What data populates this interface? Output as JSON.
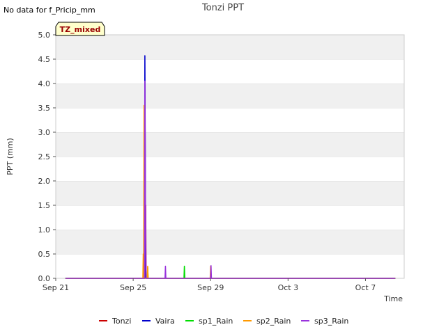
{
  "chart_data": {
    "type": "line",
    "title": "Tonzi PPT",
    "note": "No data for f_Pricip_mm",
    "badge": "TZ_mixed",
    "xlabel": "Time",
    "ylabel": "PPT (mm)",
    "xlim": [
      "2023-09-21",
      "2023-10-09"
    ],
    "ylim": [
      0,
      5.0
    ],
    "x_ticks": [
      {
        "date": "2023-09-21",
        "label": "Sep 21"
      },
      {
        "date": "2023-09-25",
        "label": "Sep 25"
      },
      {
        "date": "2023-09-29",
        "label": "Sep 29"
      },
      {
        "date": "2023-10-03",
        "label": "Oct 3"
      },
      {
        "date": "2023-10-07",
        "label": "Oct 7"
      }
    ],
    "y_ticks": [
      "0.0",
      "0.5",
      "1.0",
      "1.5",
      "2.0",
      "2.5",
      "3.0",
      "3.5",
      "4.0",
      "4.5",
      "5.0"
    ],
    "grid": true,
    "legend_position": "bottom",
    "series": [
      {
        "name": "Tonzi",
        "color": "#cc0000",
        "points": [
          [
            "2023-09-21T12:00",
            0
          ],
          [
            "2023-09-25T13:00",
            0
          ],
          [
            "2023-09-25T13:30",
            0.75
          ],
          [
            "2023-09-25T14:00",
            0
          ],
          [
            "2023-09-25T15:00",
            0
          ],
          [
            "2023-09-25T15:30",
            1.5
          ],
          [
            "2023-09-25T16:00",
            0
          ],
          [
            "2023-10-08T13:00",
            0
          ]
        ]
      },
      {
        "name": "Vaira",
        "color": "#0000cc",
        "points": [
          [
            "2023-09-21T12:00",
            0
          ],
          [
            "2023-09-25T14:00",
            0
          ],
          [
            "2023-09-25T14:30",
            4.57
          ],
          [
            "2023-09-25T15:00",
            2.55
          ],
          [
            "2023-09-25T15:30",
            0
          ],
          [
            "2023-10-08T13:00",
            0
          ]
        ]
      },
      {
        "name": "sp1_Rain",
        "color": "#00dd00",
        "points": [
          [
            "2023-09-21T12:00",
            0
          ],
          [
            "2023-09-25T17:30",
            0
          ],
          [
            "2023-09-25T18:00",
            0.22
          ],
          [
            "2023-09-25T18:30",
            0
          ],
          [
            "2023-09-27T15:00",
            0
          ],
          [
            "2023-09-27T15:30",
            0.25
          ],
          [
            "2023-09-27T16:00",
            0
          ],
          [
            "2023-10-08T13:00",
            0
          ]
        ]
      },
      {
        "name": "sp2_Rain",
        "color": "#ff9900",
        "points": [
          [
            "2023-09-21T12:00",
            0
          ],
          [
            "2023-09-25T12:00",
            0
          ],
          [
            "2023-09-25T12:30",
            0.5
          ],
          [
            "2023-09-25T13:00",
            0
          ],
          [
            "2023-09-25T13:30",
            3.55
          ],
          [
            "2023-09-25T14:00",
            0
          ],
          [
            "2023-09-25T17:30",
            0
          ],
          [
            "2023-09-25T18:00",
            0.25
          ],
          [
            "2023-09-25T18:30",
            0
          ],
          [
            "2023-09-28T23:30",
            0
          ],
          [
            "2023-09-29T00:00",
            0.25
          ],
          [
            "2023-09-29T00:30",
            0
          ],
          [
            "2023-10-08T13:00",
            0
          ]
        ]
      },
      {
        "name": "sp3_Rain",
        "color": "#9933dd",
        "points": [
          [
            "2023-09-21T12:00",
            0
          ],
          [
            "2023-09-25T14:00",
            0
          ],
          [
            "2023-09-25T14:30",
            4.05
          ],
          [
            "2023-09-25T15:00",
            2.3
          ],
          [
            "2023-09-25T15:30",
            0.85
          ],
          [
            "2023-09-25T16:00",
            0
          ],
          [
            "2023-09-26T15:30",
            0
          ],
          [
            "2023-09-26T16:00",
            0.25
          ],
          [
            "2023-09-26T16:30",
            0
          ],
          [
            "2023-09-29T00:00",
            0
          ],
          [
            "2023-09-29T00:30",
            0.26
          ],
          [
            "2023-09-29T01:00",
            0
          ],
          [
            "2023-10-08T13:00",
            0
          ]
        ]
      }
    ]
  }
}
